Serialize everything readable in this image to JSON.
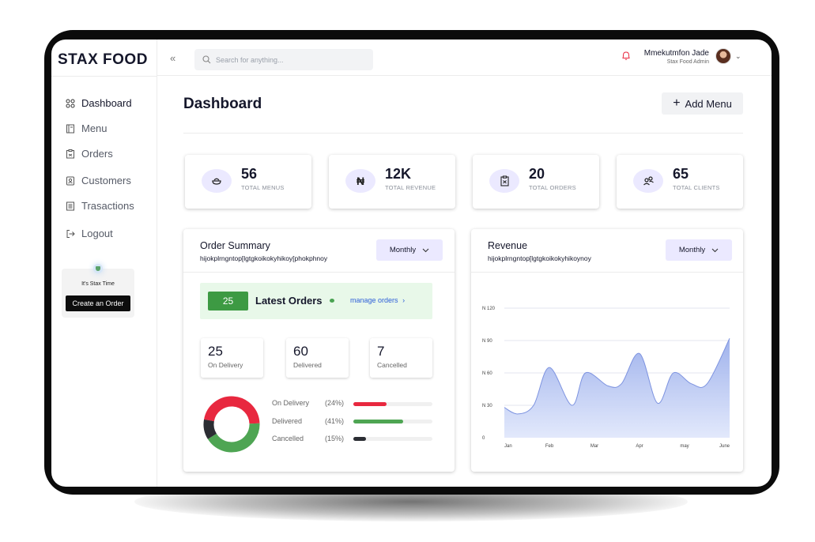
{
  "brand": "STAX FOOD",
  "sidebar": {
    "items": [
      {
        "label": "Dashboard",
        "icon": "grid-icon"
      },
      {
        "label": "Menu",
        "icon": "book-icon"
      },
      {
        "label": "Orders",
        "icon": "clipboard-icon"
      },
      {
        "label": "Customers",
        "icon": "contact-card-icon"
      },
      {
        "label": "Trasactions",
        "icon": "receipt-icon"
      },
      {
        "label": "Logout",
        "icon": "logout-icon"
      }
    ],
    "promo_text": "It's Stax Time",
    "promo_button": "Create an Order"
  },
  "topbar": {
    "search_placeholder": "Search for anything...",
    "user_name": "Mmekutmfon Jade",
    "user_role": "Stax Food Admin"
  },
  "main": {
    "title": "Dashboard",
    "add_button": "Add Menu"
  },
  "stats": [
    {
      "value": "56",
      "label": "TOTAL MENUS",
      "icon": "bowl-icon"
    },
    {
      "value": "12K",
      "label": "TOTAL REVENUE",
      "icon": "naira-icon"
    },
    {
      "value": "20",
      "label": "TOTAL ORDERS",
      "icon": "clipboard-icon"
    },
    {
      "value": "65",
      "label": "TOTAL CLIENTS",
      "icon": "users-icon"
    }
  ],
  "order_summary": {
    "title": "Order Summary",
    "subtitle": "hijokplrngntop[lgtgkoikokyhikoy[phokphnoy",
    "dropdown": "Monthly",
    "latest_count": "25",
    "latest_label": "Latest Orders",
    "manage_link": "manage orders",
    "boxes": [
      {
        "value": "25",
        "label": "On Delivery"
      },
      {
        "value": "60",
        "label": "Delivered"
      },
      {
        "value": "7",
        "label": "Cancelled"
      }
    ],
    "breakdown": [
      {
        "label": "On Delivery",
        "pct_text": "(24%)",
        "pct": 0.24,
        "bar": 0.42,
        "color": "#e8283f"
      },
      {
        "label": "Delivered",
        "pct_text": "(41%)",
        "pct": 0.41,
        "bar": 0.63,
        "color": "#4ea553"
      },
      {
        "label": "Cancelled",
        "pct_text": "(15%)",
        "pct": 0.15,
        "bar": 0.16,
        "color": "#2b2d33"
      }
    ]
  },
  "revenue": {
    "title": "Revenue",
    "subtitle": "hijokplrngntop[lgtgkoikokyhikoynoy",
    "dropdown": "Monthly"
  },
  "chart_data": {
    "type": "area",
    "title": "Revenue",
    "x": [
      "Jan",
      "Feb",
      "Mar",
      "Apr",
      "may",
      "June"
    ],
    "y_ticks": [
      "0",
      "N 30",
      "N 60",
      "N 90",
      "N 120"
    ],
    "ylim": [
      0,
      120
    ],
    "series": [
      {
        "x": [
          0,
          0.3,
          0.65,
          1.0,
          1.5,
          1.8,
          2.3,
          2.6,
          3.0,
          3.4,
          3.75,
          4.15,
          4.5,
          5.0
        ],
        "values": [
          28,
          22,
          30,
          65,
          30,
          60,
          48,
          50,
          78,
          32,
          60,
          50,
          50,
          92
        ]
      }
    ],
    "color": "#9aaeeb",
    "grid": true
  }
}
